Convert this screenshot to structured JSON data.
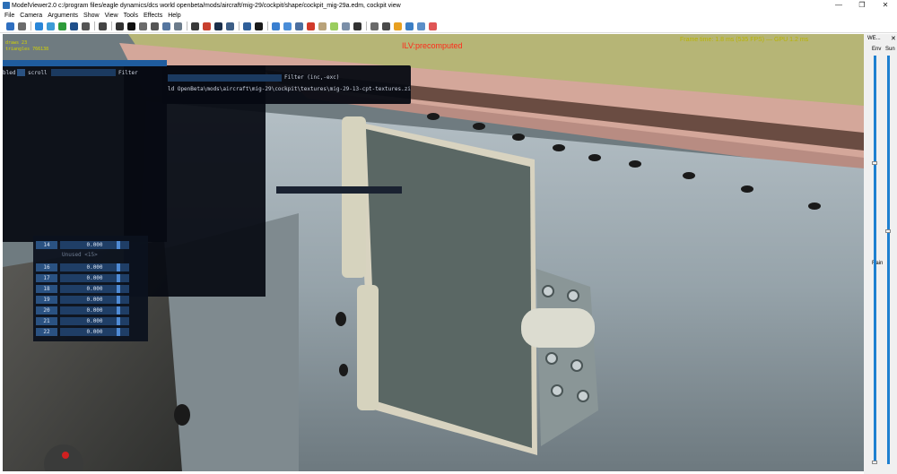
{
  "window": {
    "title": "ModelViewer2.0 c:/program files/eagle dynamics/dcs world openbeta/mods/aircraft/mig-29/cockpit/shape/cockpit_mig-29a.edm, cockpit view",
    "controls": {
      "minimize": "—",
      "maximize": "❐",
      "close": "✕"
    }
  },
  "menu": {
    "items": [
      {
        "label": "File"
      },
      {
        "label": "Camera"
      },
      {
        "label": "Arguments"
      },
      {
        "label": "Show"
      },
      {
        "label": "View"
      },
      {
        "label": "Tools"
      },
      {
        "label": "Effects"
      },
      {
        "label": "Help"
      }
    ]
  },
  "toolbar": {
    "buttons": [
      {
        "icon": "save-icon",
        "color": "#2f6fc0"
      },
      {
        "icon": "open-icon",
        "color": "#6b6b6b"
      },
      {
        "icon": "sep"
      },
      {
        "icon": "globe-icon",
        "color": "#2a86d8"
      },
      {
        "icon": "refresh-icon",
        "color": "#3d9bd6"
      },
      {
        "icon": "reload-green-icon",
        "color": "#2e9b3a"
      },
      {
        "icon": "reset-icon",
        "color": "#1f4f8a"
      },
      {
        "icon": "rotate-icon",
        "color": "#555555"
      },
      {
        "icon": "sep"
      },
      {
        "icon": "bug-icon",
        "color": "#444444"
      },
      {
        "icon": "sep"
      },
      {
        "icon": "crosshair-icon",
        "color": "#333333"
      },
      {
        "icon": "black-square-icon",
        "color": "#111111"
      },
      {
        "icon": "skeleton-icon",
        "color": "#6b6b6b"
      },
      {
        "icon": "bone-icon",
        "color": "#555555"
      },
      {
        "icon": "arrow-icon",
        "color": "#5576a0"
      },
      {
        "icon": "speaker-icon",
        "color": "#6b7b8b"
      },
      {
        "icon": "sep"
      },
      {
        "icon": "film-icon",
        "color": "#3a3a3a"
      },
      {
        "icon": "palette-icon",
        "color": "#c8402e"
      },
      {
        "icon": "monitor-icon",
        "color": "#1b2f4a"
      },
      {
        "icon": "stack-icon",
        "color": "#3d5e86"
      },
      {
        "icon": "sep"
      },
      {
        "icon": "redo-icon",
        "color": "#2f5f9a"
      },
      {
        "icon": "black-circle-icon",
        "color": "#1a1a1a"
      },
      {
        "icon": "sep"
      },
      {
        "icon": "bar-chart-icon",
        "color": "#3a7fd0"
      },
      {
        "icon": "sphere-icon",
        "color": "#4a8dd8"
      },
      {
        "icon": "cube-icon",
        "color": "#4c6fa0"
      },
      {
        "icon": "red-cube-icon",
        "color": "#d13a2a"
      },
      {
        "icon": "box-icon",
        "color": "#b9a37a"
      },
      {
        "icon": "green-light-icon",
        "color": "#9acd5e"
      },
      {
        "icon": "material-icon",
        "color": "#7b8fa8"
      },
      {
        "icon": "cursor-icon",
        "color": "#333333"
      },
      {
        "icon": "sep"
      },
      {
        "icon": "ship-icon",
        "color": "#6a6a6a"
      },
      {
        "icon": "plane-icon",
        "color": "#4a4a4a"
      },
      {
        "icon": "sun-icon",
        "color": "#e8a020"
      },
      {
        "icon": "flask-icon",
        "color": "#3c7fc5"
      },
      {
        "icon": "list-icon",
        "color": "#5c8fc8"
      },
      {
        "icon": "stop-icon",
        "color": "#e05555"
      }
    ]
  },
  "viewport": {
    "ilv_label": "ILV:precomputed",
    "yellow_stat": "Frame time: 1.8 ms (535 FPS) — GPU 1.2 ms",
    "stats": [
      "draws 23",
      "triangles 766138"
    ]
  },
  "path_panel": {
    "filter_label": "Filter (inc,-exc)",
    "path": "ld OpenBeta\\mods\\aircraft\\mig-29\\cockpit\\textures\\mig-29-13-cpt-textures.zi"
  },
  "args_panel": {
    "enabled_label": "bled",
    "scroll_label": "scroll",
    "filter_label": "Filter",
    "rows": [
      {
        "num": "14",
        "value": "0.000"
      },
      {
        "section": "Unused <15>"
      },
      {
        "num": "16",
        "value": "0.000"
      },
      {
        "num": "17",
        "value": "0.000"
      },
      {
        "num": "18",
        "value": "0.000"
      },
      {
        "num": "19",
        "value": "0.000"
      },
      {
        "num": "20",
        "value": "0.000"
      },
      {
        "num": "21",
        "value": "0.000"
      },
      {
        "num": "22",
        "value": "0.000"
      }
    ]
  },
  "weather_panel": {
    "title": "WE...",
    "close": "✕",
    "env_label": "Env",
    "sun_label": "Sun",
    "rain_label": "Rain",
    "env_level": 0.74,
    "sun_level": 0.57,
    "rain_level": 0.0
  }
}
